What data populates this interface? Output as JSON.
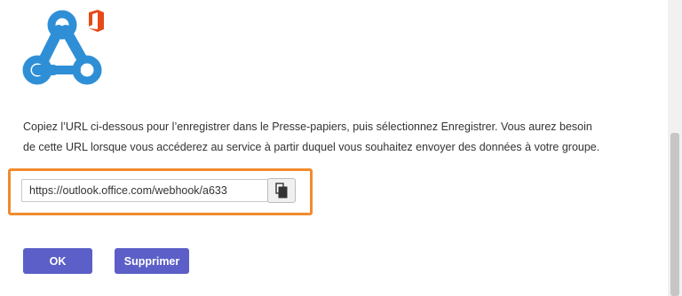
{
  "dialog": {
    "description_line1": "Copiez l’URL ci-dessous pour l’enregistrer dans le Presse-papiers, puis sélectionnez Enregistrer. Vous aurez besoin",
    "description_line2": "de cette URL lorsque vous accéderez au service à partir duquel vous souhaitez envoyer des données à votre groupe.",
    "webhook_url": "https://outlook.office.com/webhook/a633",
    "ok_label": "OK",
    "delete_label": "Supprimer"
  },
  "icons": {
    "logo": "webhook-icon",
    "badge": "office-logo-icon",
    "copy": "copy-icon"
  },
  "colors": {
    "accent": "#5b5fc7",
    "highlight": "#f28a2e",
    "webhook_blue": "#2f8fd6",
    "office_red": "#e64a19"
  }
}
